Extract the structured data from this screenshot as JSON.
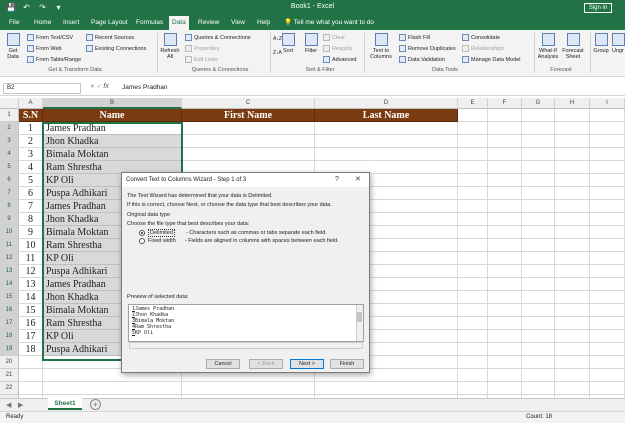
{
  "window": {
    "title": "Book1  -  Excel",
    "signin_label": "Sign in"
  },
  "quick_access": {
    "save": "💾",
    "undo": "↶",
    "redo": "↷",
    "customize": "▾"
  },
  "tabs": [
    "File",
    "Home",
    "Insert",
    "Page Layout",
    "Formulas",
    "Data",
    "Review",
    "View",
    "Help",
    "Tell me what you want to do"
  ],
  "active_tab": "Data",
  "ribbon": {
    "get_data": "Get Data",
    "from_text_csv": "From Text/CSV",
    "from_web": "From Web",
    "from_table_range": "From Table/Range",
    "recent_sources": "Recent Sources",
    "existing_connections": "Existing Connections",
    "refresh_all": "Refresh All",
    "queries_connections": "Queries & Connections",
    "properties": "Properties",
    "edit_links": "Edit Links",
    "sort_asc": "A↓Z",
    "sort_desc": "Z↓A",
    "sort": "Sort",
    "filter": "Filter",
    "clear": "Clear",
    "reapply": "Reapply",
    "advanced": "Advanced",
    "text_to_columns": "Text to Columns",
    "flash_fill": "Flash Fill",
    "remove_duplicates": "Remove Duplicates",
    "data_validation": "Data Validation",
    "consolidate": "Consolidate",
    "relationships": "Relationships",
    "manage_data_model": "Manage Data Model",
    "what_if": "What-If Analysis",
    "forecast_sheet": "Forecast Sheet",
    "group": "Group",
    "ungroup": "Ungr",
    "groups": {
      "get_transform": "Get & Transform Data",
      "queries": "Queries & Connections",
      "sort_filter": "Sort & Filter",
      "data_tools": "Data Tools",
      "forecast": "Forecast"
    }
  },
  "formula_bar": {
    "name_box": "B2",
    "fx": "fx",
    "value": "James Pradhan"
  },
  "columns": [
    "A",
    "B",
    "C",
    "D",
    "E",
    "F",
    "G",
    "H",
    "I"
  ],
  "table": {
    "headers": [
      "S.N",
      "Name",
      "First Name",
      "Last Name"
    ],
    "rows": [
      [
        "1",
        "James Pradhan"
      ],
      [
        "2",
        "Jhon Khadka"
      ],
      [
        "3",
        "Bimala Moktan"
      ],
      [
        "4",
        "Ram Shrestha"
      ],
      [
        "5",
        "KP Oli"
      ],
      [
        "6",
        "Puspa Adhikari"
      ],
      [
        "7",
        "James Pradhan"
      ],
      [
        "8",
        "Jhon Khadka"
      ],
      [
        "9",
        "Bimala Moktan"
      ],
      [
        "10",
        "Ram Shrestha"
      ],
      [
        "11",
        "KP Oli"
      ],
      [
        "12",
        "Puspa Adhikari"
      ],
      [
        "13",
        "James Pradhan"
      ],
      [
        "14",
        "Jhon Khadka"
      ],
      [
        "15",
        "Bimala Moktan"
      ],
      [
        "16",
        "Ram Shrestha"
      ],
      [
        "17",
        "KP Oli"
      ],
      [
        "18",
        "Puspa Adhikari"
      ]
    ]
  },
  "row_numbers": [
    "1",
    "2",
    "3",
    "4",
    "5",
    "6",
    "7",
    "8",
    "9",
    "10",
    "11",
    "12",
    "13",
    "14",
    "15",
    "16",
    "17",
    "18",
    "19",
    "20",
    "21",
    "22",
    "23"
  ],
  "dialog": {
    "title": "Convert Text to Columns Wizard - Step 1 of 3",
    "help": "?",
    "close": "✕",
    "line1": "The Text Wizard has determined that your data is Delimited.",
    "line2": "If this is correct, choose Next, or choose the data type that best describes your data.",
    "section": "Original data type",
    "choose": "Choose the file type that best describes your data:",
    "opt_delimited": "Delimited",
    "opt_delimited_desc": "- Characters such as commas or tabs separate each field.",
    "opt_fixed": "Fixed width",
    "opt_fixed_desc": "- Fields are aligned in columns with spaces between each field.",
    "preview_label": "Preview of selected data:",
    "preview": [
      {
        "n": "1",
        "text": "James Pradhan"
      },
      {
        "n": "2",
        "text": "Jhon Khadka"
      },
      {
        "n": "3",
        "text": "Bimala Moktan"
      },
      {
        "n": "4",
        "text": "Ram Shrestha"
      },
      {
        "n": "5",
        "text": "KP Oli"
      }
    ],
    "btn_cancel": "Cancel",
    "btn_back": "< Back",
    "btn_next": "Next >",
    "btn_finish": "Finish"
  },
  "sheet_tab": "Sheet1",
  "add_sheet": "+",
  "status": {
    "ready": "Ready",
    "count": "Count: 18"
  },
  "colors": {
    "excel_green": "#217346",
    "header_fill": "#7b3b10"
  }
}
